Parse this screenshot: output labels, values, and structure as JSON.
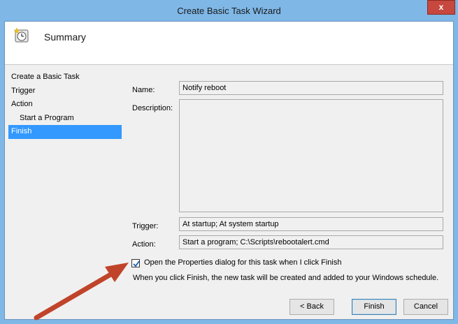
{
  "window": {
    "title": "Create Basic Task Wizard",
    "close_label": "x"
  },
  "header": {
    "title": "Summary"
  },
  "nav": {
    "items": [
      {
        "label": "Create a Basic Task"
      },
      {
        "label": "Trigger"
      },
      {
        "label": "Action"
      },
      {
        "label": "Start a Program"
      },
      {
        "label": "Finish"
      }
    ],
    "selected": "Finish"
  },
  "form": {
    "name_label": "Name:",
    "name_value": "Notify reboot",
    "description_label": "Description:",
    "description_value": "",
    "trigger_label": "Trigger:",
    "trigger_value": "At startup; At system startup",
    "action_label": "Action:",
    "action_value": "Start a program; C:\\Scripts\\rebootalert.cmd"
  },
  "options": {
    "open_properties_label": "Open the Properties dialog for this task when I click Finish",
    "open_properties_checked": true,
    "info_text": "When you click Finish, the new task will be created and added to your Windows schedule."
  },
  "buttons": {
    "back": "< Back",
    "finish": "Finish",
    "cancel": "Cancel"
  },
  "colors": {
    "titlebar": "#7fb7e6",
    "selection": "#3399ff",
    "close": "#c7483f",
    "annotation_arrow": "#c0442a"
  }
}
